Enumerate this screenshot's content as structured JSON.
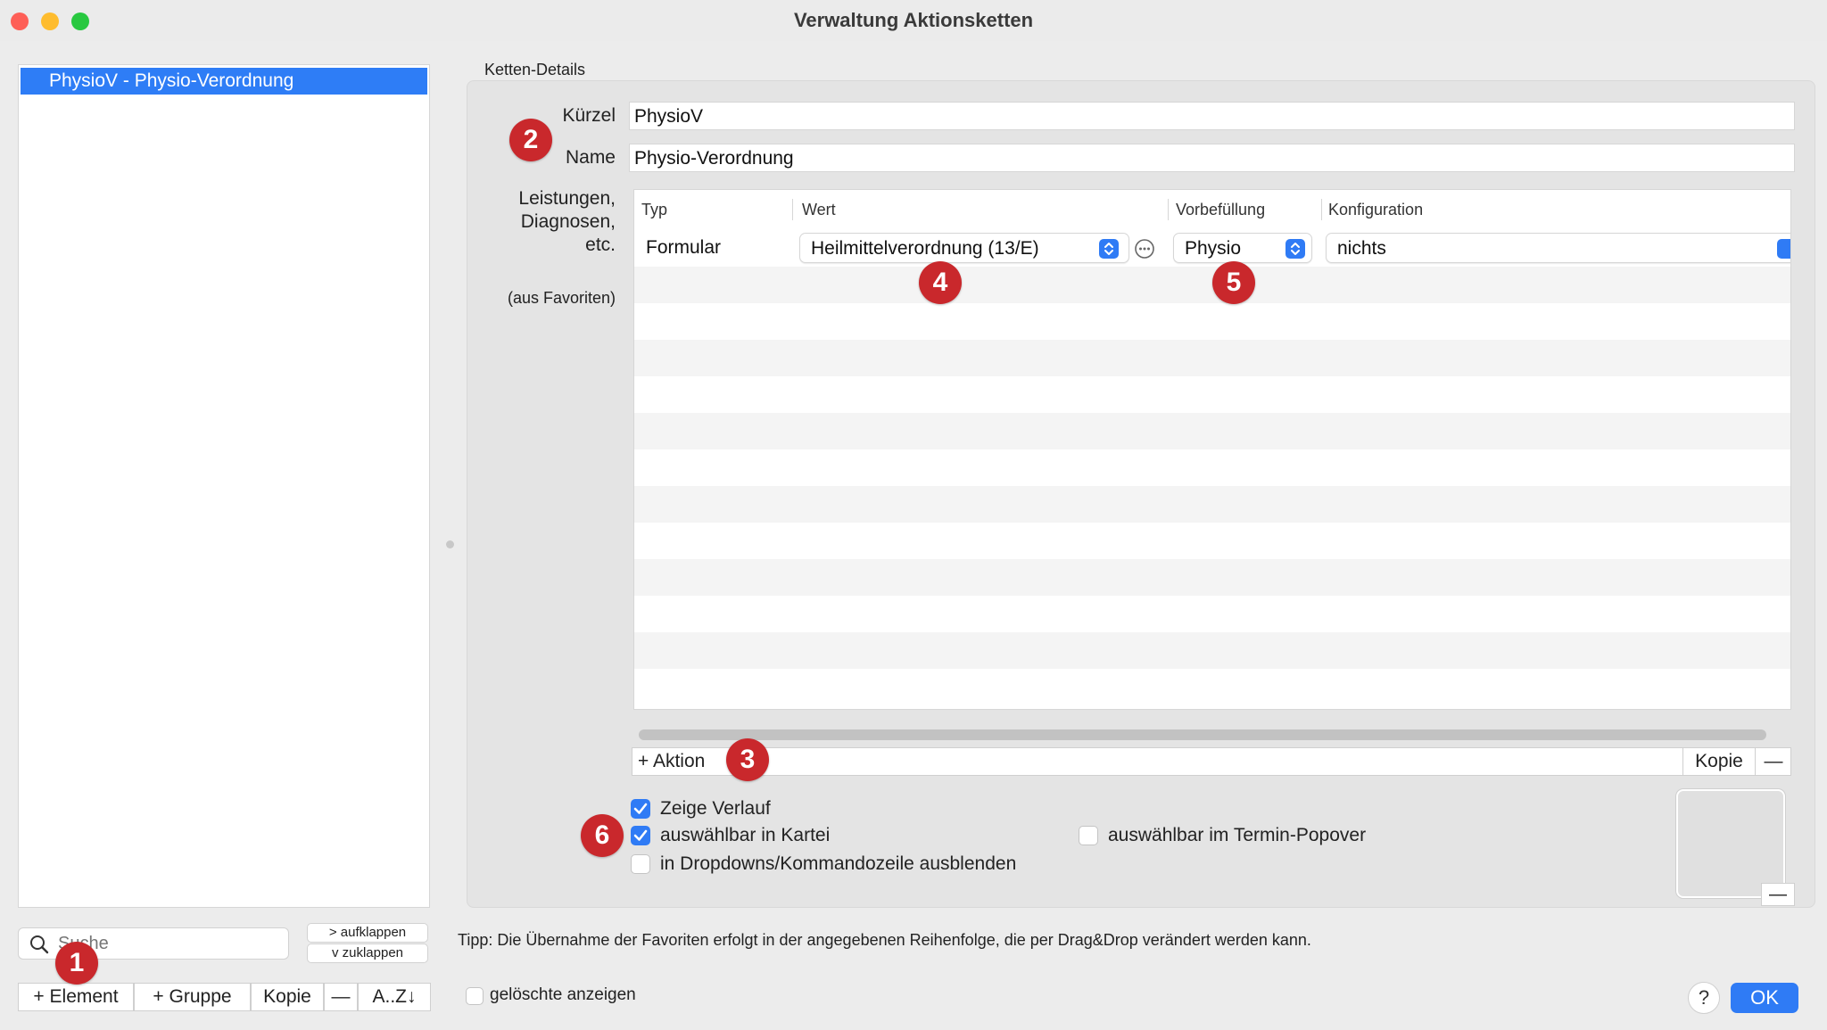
{
  "window": {
    "title": "Verwaltung Aktionsketten"
  },
  "left": {
    "items": [
      {
        "label": "PhysioV - Physio-Verordnung",
        "selected": true
      }
    ],
    "search": {
      "placeholder": "Suche",
      "value": ""
    },
    "expand_label": "> aufklappen",
    "collapse_label": "v  zuklappen",
    "toolbar": {
      "add_element": "+ Element",
      "add_group": "+ Gruppe",
      "copy": "Kopie",
      "remove": "—",
      "sort": "A..Z↓"
    }
  },
  "details": {
    "group_label": "Ketten-Details",
    "kuerzel_label": "Kürzel",
    "kuerzel_value": "PhysioV",
    "name_label": "Name",
    "name_value": "Physio-Verordnung",
    "leistungen_label_1": "Leistungen,",
    "leistungen_label_2": "Diagnosen,",
    "leistungen_label_3": "etc.",
    "favoriten_label": "(aus Favoriten)",
    "table": {
      "columns": [
        "Typ",
        "Wert",
        "Vorbefüllung",
        "Konfiguration"
      ],
      "rows": [
        {
          "typ": "Formular",
          "wert": "Heilmittelverordnung (13/E)",
          "vorbefuellung": "Physio",
          "konfiguration": "nichts"
        }
      ]
    },
    "action_bar": {
      "add_action": "+ Aktion",
      "copy": "Kopie",
      "remove": "—"
    },
    "checkboxes": {
      "zeige_verlauf": {
        "label": "Zeige Verlauf",
        "checked": true
      },
      "kartei": {
        "label": "auswählbar in Kartei",
        "checked": true
      },
      "termin_popover": {
        "label": "auswählbar im Termin-Popover",
        "checked": false
      },
      "dropdowns": {
        "label": "in Dropdowns/Kommandozeile ausblenden",
        "checked": false
      }
    },
    "image_remove": "—"
  },
  "tip": "Tipp: Die Übernahme der Favoriten erfolgt in der angegebenen Reihenfolge, die per Drag&Drop verändert werden kann.",
  "footer": {
    "show_deleted": {
      "label": "gelöschte anzeigen",
      "checked": false
    },
    "help": "?",
    "ok": "OK"
  },
  "badges": [
    "1",
    "2",
    "3",
    "4",
    "5",
    "6"
  ],
  "colors": {
    "accent": "#2f7bf5",
    "badge": "#c9282c",
    "close": "#fe5f57",
    "minimize": "#febc2e",
    "zoom": "#28c840"
  }
}
